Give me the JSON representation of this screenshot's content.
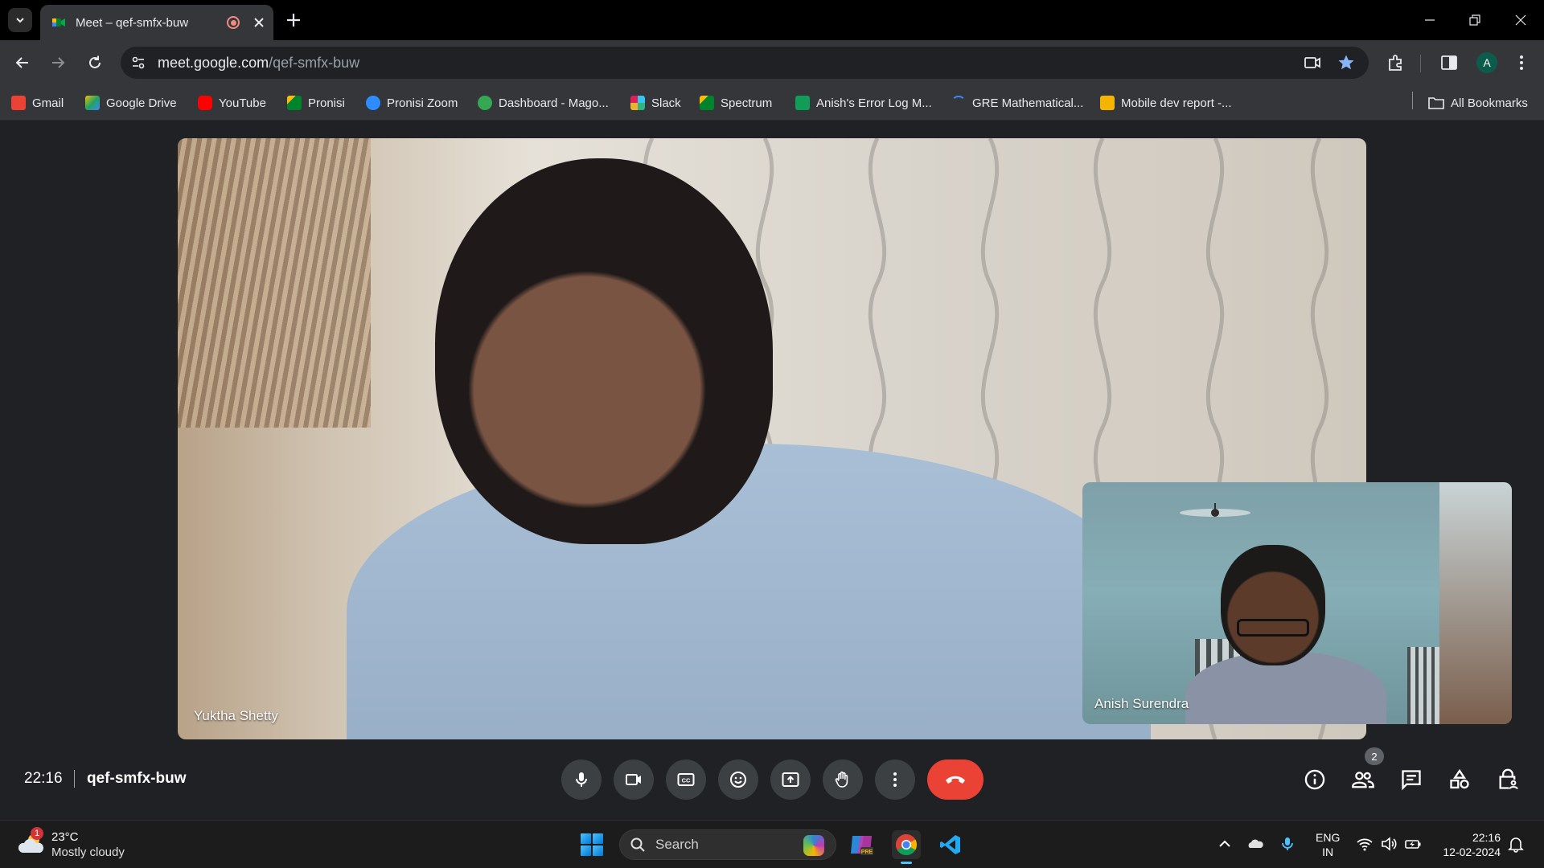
{
  "browser": {
    "tab_title": "Meet – qef-smfx-buw",
    "url_host": "meet.google.com",
    "url_path": "/qef-smfx-buw"
  },
  "bookmarks": [
    {
      "label": "Gmail",
      "icon": "gmail-icon",
      "color": "#ea4335"
    },
    {
      "label": "Google Drive",
      "icon": "google-drive-icon",
      "color": "#1fa463"
    },
    {
      "label": "YouTube",
      "icon": "youtube-icon",
      "color": "#ff0000"
    },
    {
      "label": "Pronisi",
      "icon": "meet-icon",
      "color": "#00832d"
    },
    {
      "label": "Pronisi Zoom",
      "icon": "zoom-icon",
      "color": "#2d8cff"
    },
    {
      "label": "Dashboard - Mago...",
      "icon": "dashboard-icon",
      "color": "#34a853"
    },
    {
      "label": "Slack",
      "icon": "slack-icon",
      "color": "#e01e5a"
    },
    {
      "label": "Spectrum",
      "icon": "meet-icon",
      "color": "#00832d"
    },
    {
      "label": "Anish's Error Log M...",
      "icon": "sheets-icon",
      "color": "#0f9d58"
    },
    {
      "label": "GRE Mathematical...",
      "icon": "loading-icon",
      "color": "#4285f4"
    },
    {
      "label": "Mobile dev report -...",
      "icon": "slides-icon",
      "color": "#f4b400"
    }
  ],
  "all_bookmarks_label": "All Bookmarks",
  "profile_initial": "A",
  "meet": {
    "main_participant": "Yuktha Shetty",
    "self_participant": "Anish Surendra",
    "time": "22:16",
    "meeting_code": "qef-smfx-buw",
    "participant_count": "2",
    "end_call_color": "#ea4335",
    "accent": "#1a73e8"
  },
  "taskbar": {
    "weather_badge": "1",
    "temperature": "23°C",
    "condition": "Mostly cloudy",
    "search_placeholder": "Search",
    "lang_line1": "ENG",
    "lang_line2": "IN",
    "time": "22:16",
    "date": "12-02-2024"
  }
}
